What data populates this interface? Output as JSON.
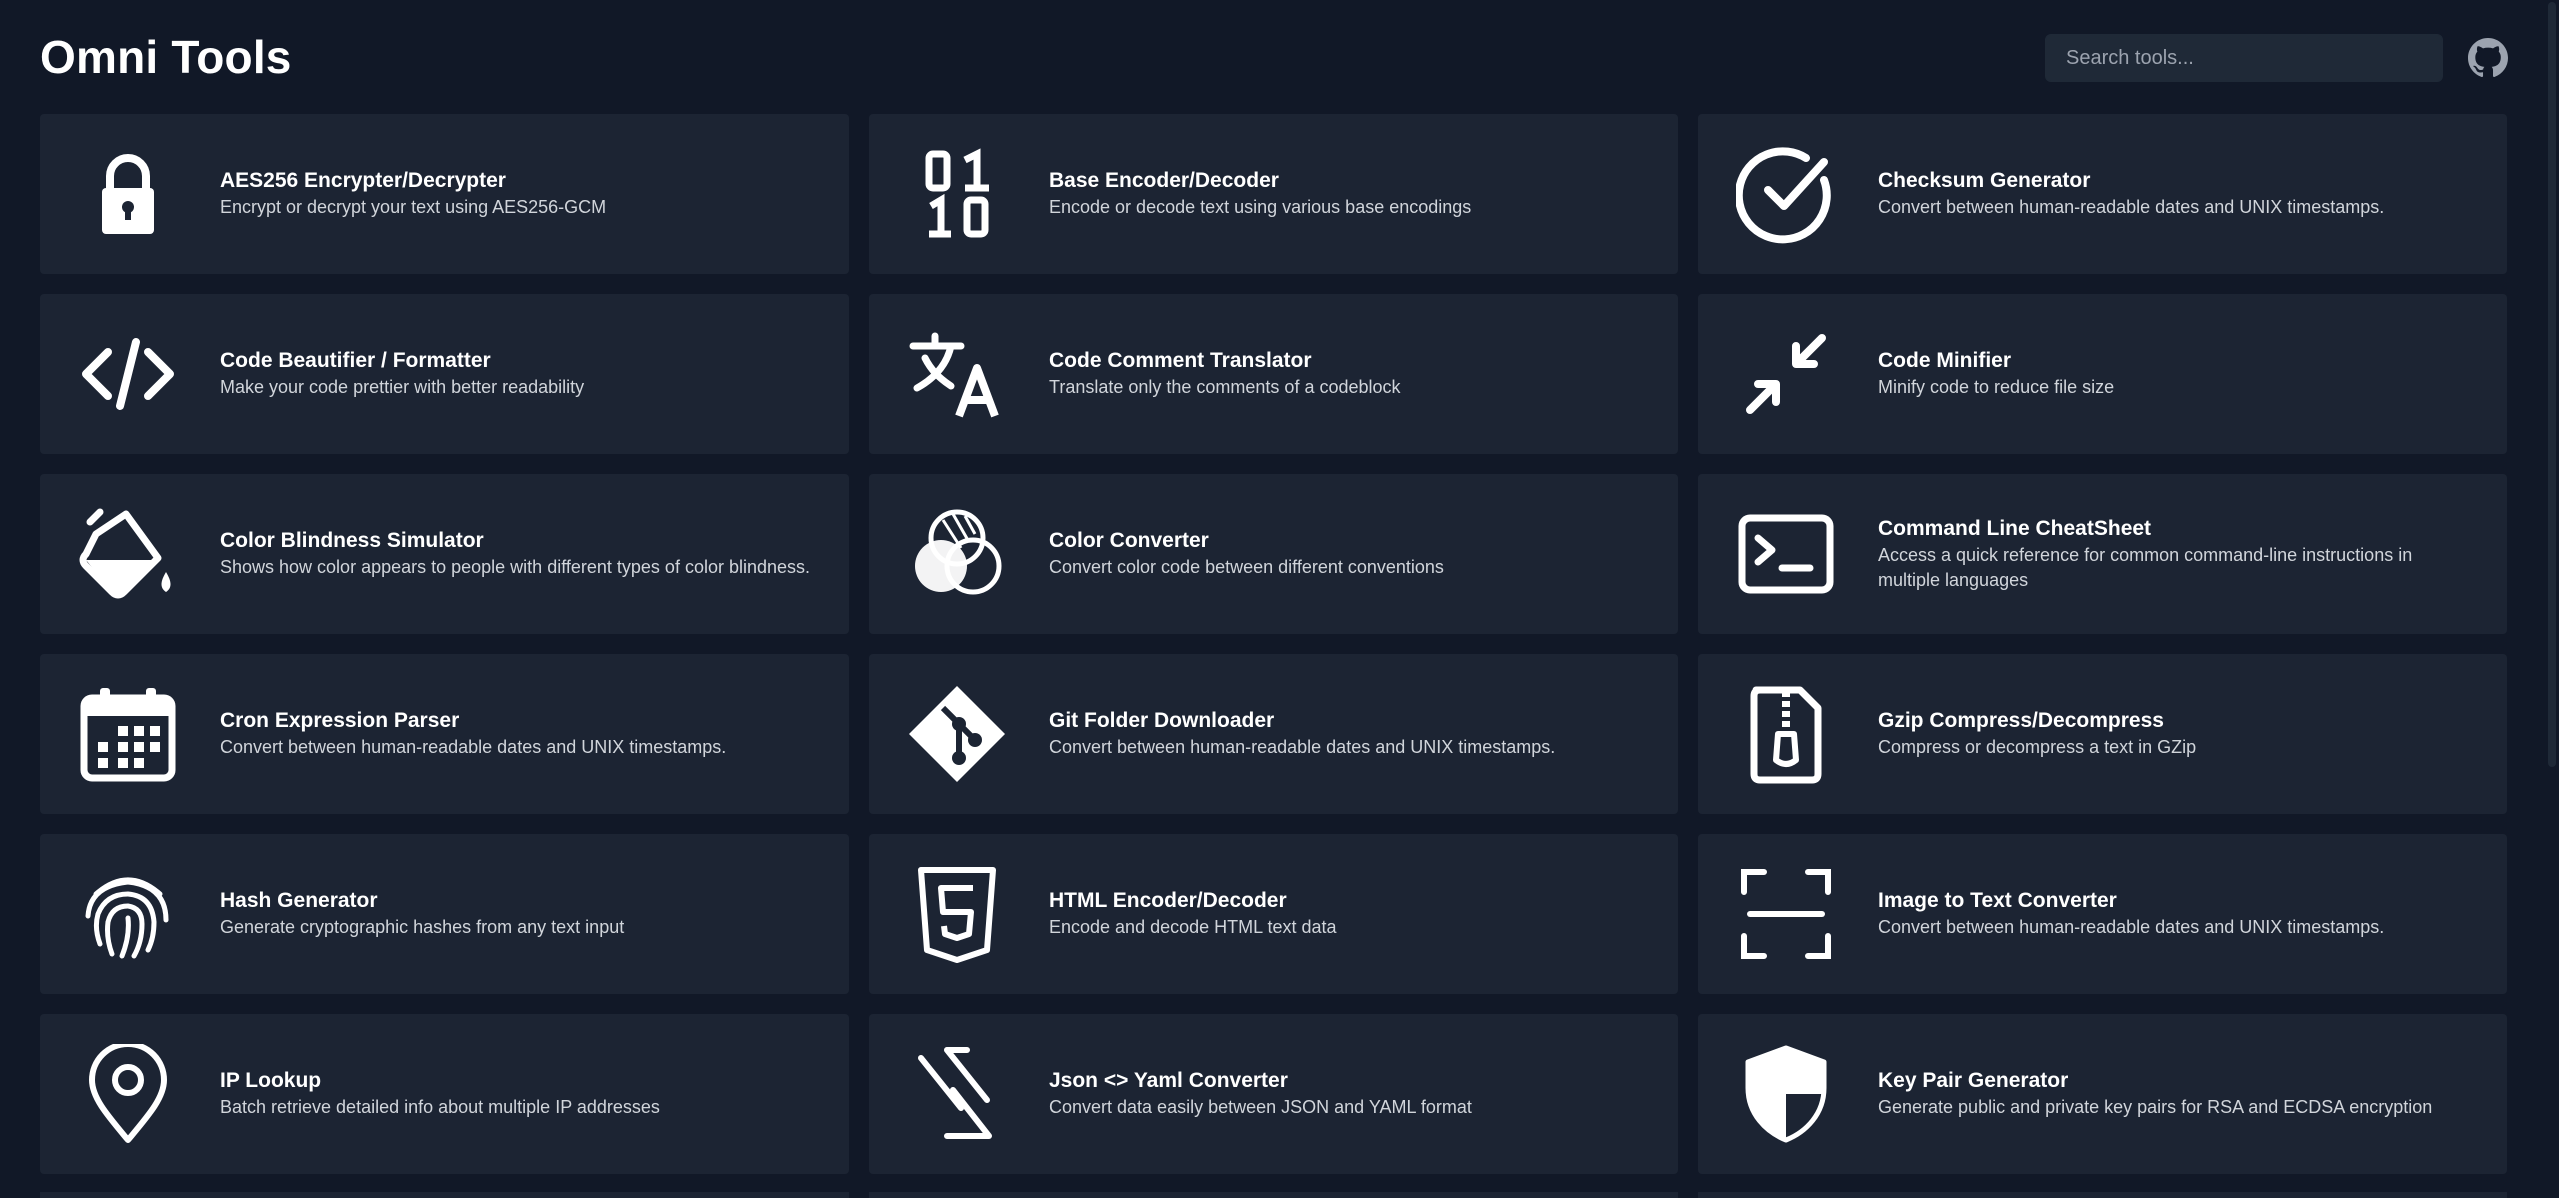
{
  "app": {
    "title": "Omni Tools",
    "search_placeholder": "Search tools...",
    "github_icon": "github-icon"
  },
  "colors": {
    "background": "#111827",
    "card": "#1c2433",
    "text": "#ffffff",
    "muted": "#d1d5db"
  },
  "tools": [
    {
      "name": "AES256 Encrypter/Decrypter",
      "description": "Encrypt or decrypt your text using AES256-GCM",
      "icon": "lock-icon"
    },
    {
      "name": "Base Encoder/Decoder",
      "description": "Encode or decode text using various base encodings",
      "icon": "binary-icon"
    },
    {
      "name": "Checksum Generator",
      "description": "Convert between human-readable dates and UNIX timestamps.",
      "icon": "check-circle-icon"
    },
    {
      "name": "Code Beautifier / Formatter",
      "description": "Make your code prettier with better readability",
      "icon": "code-icon"
    },
    {
      "name": "Code Comment Translator",
      "description": "Translate only the comments of a codeblock",
      "icon": "translate-icon"
    },
    {
      "name": "Code Minifier",
      "description": "Minify code to reduce file size",
      "icon": "minimize-arrows-icon"
    },
    {
      "name": "Color Blindness Simulator",
      "description": "Shows how color appears to people with different types of color blindness.",
      "icon": "paint-bucket-icon"
    },
    {
      "name": "Color Converter",
      "description": "Convert color code between different conventions",
      "icon": "color-circles-icon"
    },
    {
      "name": "Command Line CheatSheet",
      "description": "Access a quick reference for common command-line instructions in multiple languages",
      "icon": "terminal-icon"
    },
    {
      "name": "Cron Expression Parser",
      "description": "Convert between human-readable dates and UNIX timestamps.",
      "icon": "calendar-icon"
    },
    {
      "name": "Git Folder Downloader",
      "description": "Convert between human-readable dates and UNIX timestamps.",
      "icon": "git-icon"
    },
    {
      "name": "Gzip Compress/Decompress",
      "description": "Compress or decompress a text in GZip",
      "icon": "zip-file-icon"
    },
    {
      "name": "Hash Generator",
      "description": "Generate cryptographic hashes from any text input",
      "icon": "fingerprint-icon"
    },
    {
      "name": "HTML Encoder/Decoder",
      "description": "Encode and decode HTML text data",
      "icon": "html5-icon"
    },
    {
      "name": "Image to Text Converter",
      "description": "Convert between human-readable dates and UNIX timestamps.",
      "icon": "scan-icon"
    },
    {
      "name": "IP Lookup",
      "description": "Batch retrieve detailed info about multiple IP addresses",
      "icon": "location-pin-icon"
    },
    {
      "name": "Json <> Yaml Converter",
      "description": "Convert data easily between JSON and YAML format",
      "icon": "json-yaml-icon"
    },
    {
      "name": "Key Pair Generator",
      "description": "Generate public and private key pairs for RSA and ECDSA encryption",
      "icon": "shield-icon"
    }
  ]
}
